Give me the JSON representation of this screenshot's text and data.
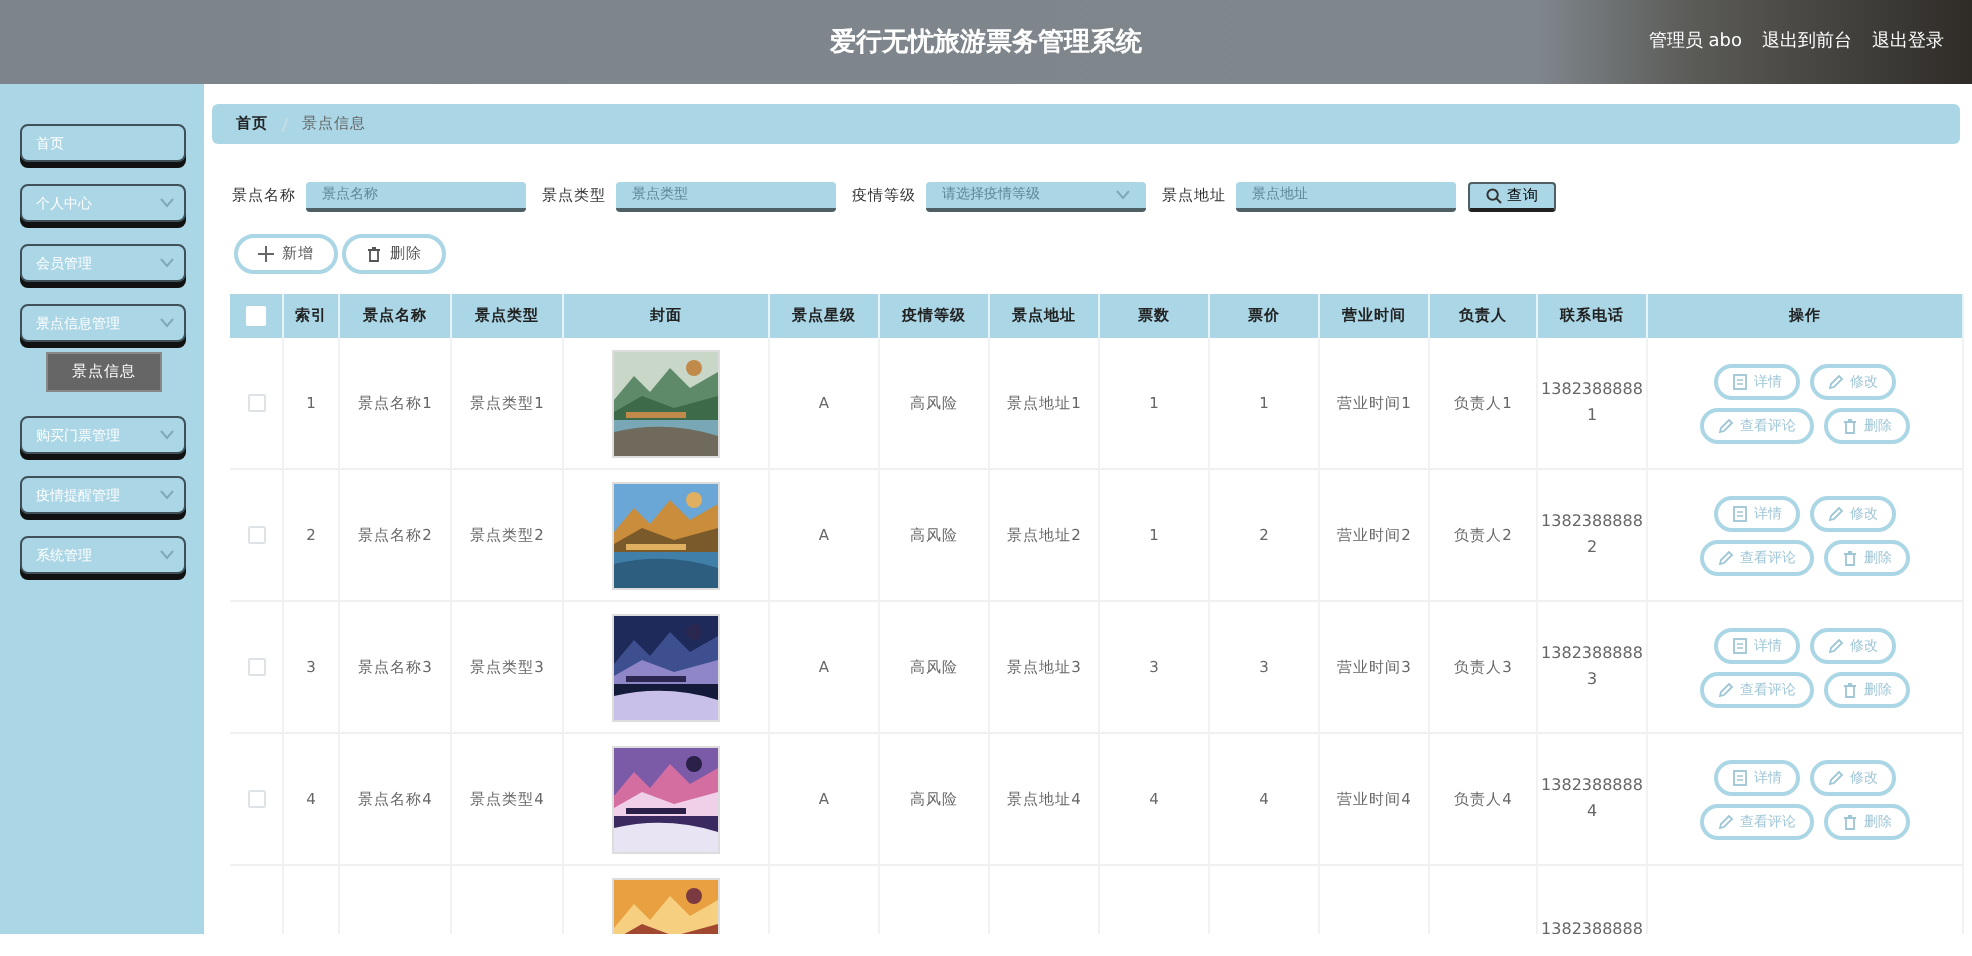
{
  "header": {
    "title": "爱行无忧旅游票务管理系统",
    "user": "管理员 abo",
    "links": [
      "退出到前台",
      "退出登录"
    ]
  },
  "sidebar": {
    "items": [
      {
        "label": "首页",
        "has_arrow": false
      },
      {
        "label": "个人中心",
        "has_arrow": true
      },
      {
        "label": "会员管理",
        "has_arrow": true
      },
      {
        "label": "景点信息管理",
        "has_arrow": true,
        "children": [
          {
            "label": "景点信息",
            "selected": true
          }
        ]
      },
      {
        "label": "购买门票管理",
        "has_arrow": true
      },
      {
        "label": "疫情提醒管理",
        "has_arrow": true
      },
      {
        "label": "系统管理",
        "has_arrow": true
      }
    ]
  },
  "breadcrumb": [
    "首页",
    "景点信息"
  ],
  "search": {
    "fields": [
      {
        "kind": "input",
        "label": "景点名称",
        "placeholder": "景点名称"
      },
      {
        "kind": "input",
        "label": "景点类型",
        "placeholder": "景点类型"
      },
      {
        "kind": "select",
        "label": "疫情等级",
        "placeholder": "请选择疫情等级"
      },
      {
        "kind": "input",
        "label": "景点地址",
        "placeholder": "景点地址"
      }
    ],
    "button": "查询"
  },
  "toolbar": [
    {
      "kind": "add",
      "label": "新增"
    },
    {
      "kind": "delete",
      "label": "删除"
    }
  ],
  "table": {
    "all_selected": false,
    "columns": [
      "索引",
      "景点名称",
      "景点类型",
      "封面",
      "景点星级",
      "疫情等级",
      "景点地址",
      "票数",
      "票价",
      "营业时间",
      "负责人",
      "联系电话",
      "操作"
    ],
    "rows": [
      {
        "selected": false,
        "cells": [
          "1",
          "景点名称1",
          "景点类型1",
          {
            "kind": "picture"
          },
          "A",
          "高风险",
          "景点地址1",
          "1",
          "1",
          "营业时间1",
          "负责人1",
          "13823888881"
        ],
        "actions": [
          {
            "kind": "detail",
            "label": "详情"
          },
          {
            "kind": "edit",
            "label": "修改"
          },
          {
            "kind": "edit",
            "label": "查看评论"
          },
          {
            "kind": "delete",
            "label": "删除"
          }
        ]
      },
      {
        "selected": false,
        "cells": [
          "2",
          "景点名称2",
          "景点类型2",
          {
            "kind": "picture"
          },
          "A",
          "高风险",
          "景点地址2",
          "1",
          "2",
          "营业时间2",
          "负责人2",
          "13823888882"
        ],
        "actions": [
          {
            "kind": "detail",
            "label": "详情"
          },
          {
            "kind": "edit",
            "label": "修改"
          },
          {
            "kind": "edit",
            "label": "查看评论"
          },
          {
            "kind": "delete",
            "label": "删除"
          }
        ]
      },
      {
        "selected": false,
        "cells": [
          "3",
          "景点名称3",
          "景点类型3",
          {
            "kind": "picture"
          },
          "A",
          "高风险",
          "景点地址3",
          "3",
          "3",
          "营业时间3",
          "负责人3",
          "13823888883"
        ],
        "actions": [
          {
            "kind": "detail",
            "label": "详情"
          },
          {
            "kind": "edit",
            "label": "修改"
          },
          {
            "kind": "edit",
            "label": "查看评论"
          },
          {
            "kind": "delete",
            "label": "删除"
          }
        ]
      },
      {
        "selected": false,
        "cells": [
          "4",
          "景点名称4",
          "景点类型4",
          {
            "kind": "picture"
          },
          "A",
          "高风险",
          "景点地址4",
          "4",
          "4",
          "营业时间4",
          "负责人4",
          "13823888884"
        ],
        "actions": [
          {
            "kind": "detail",
            "label": "详情"
          },
          {
            "kind": "edit",
            "label": "修改"
          },
          {
            "kind": "edit",
            "label": "查看评论"
          },
          {
            "kind": "delete",
            "label": "删除"
          }
        ]
      },
      {
        "cells": [
          null,
          null,
          null,
          {
            "kind": "picture"
          },
          null,
          null,
          null,
          null,
          null,
          null,
          null,
          "1382388888"
        ]
      }
    ]
  }
}
